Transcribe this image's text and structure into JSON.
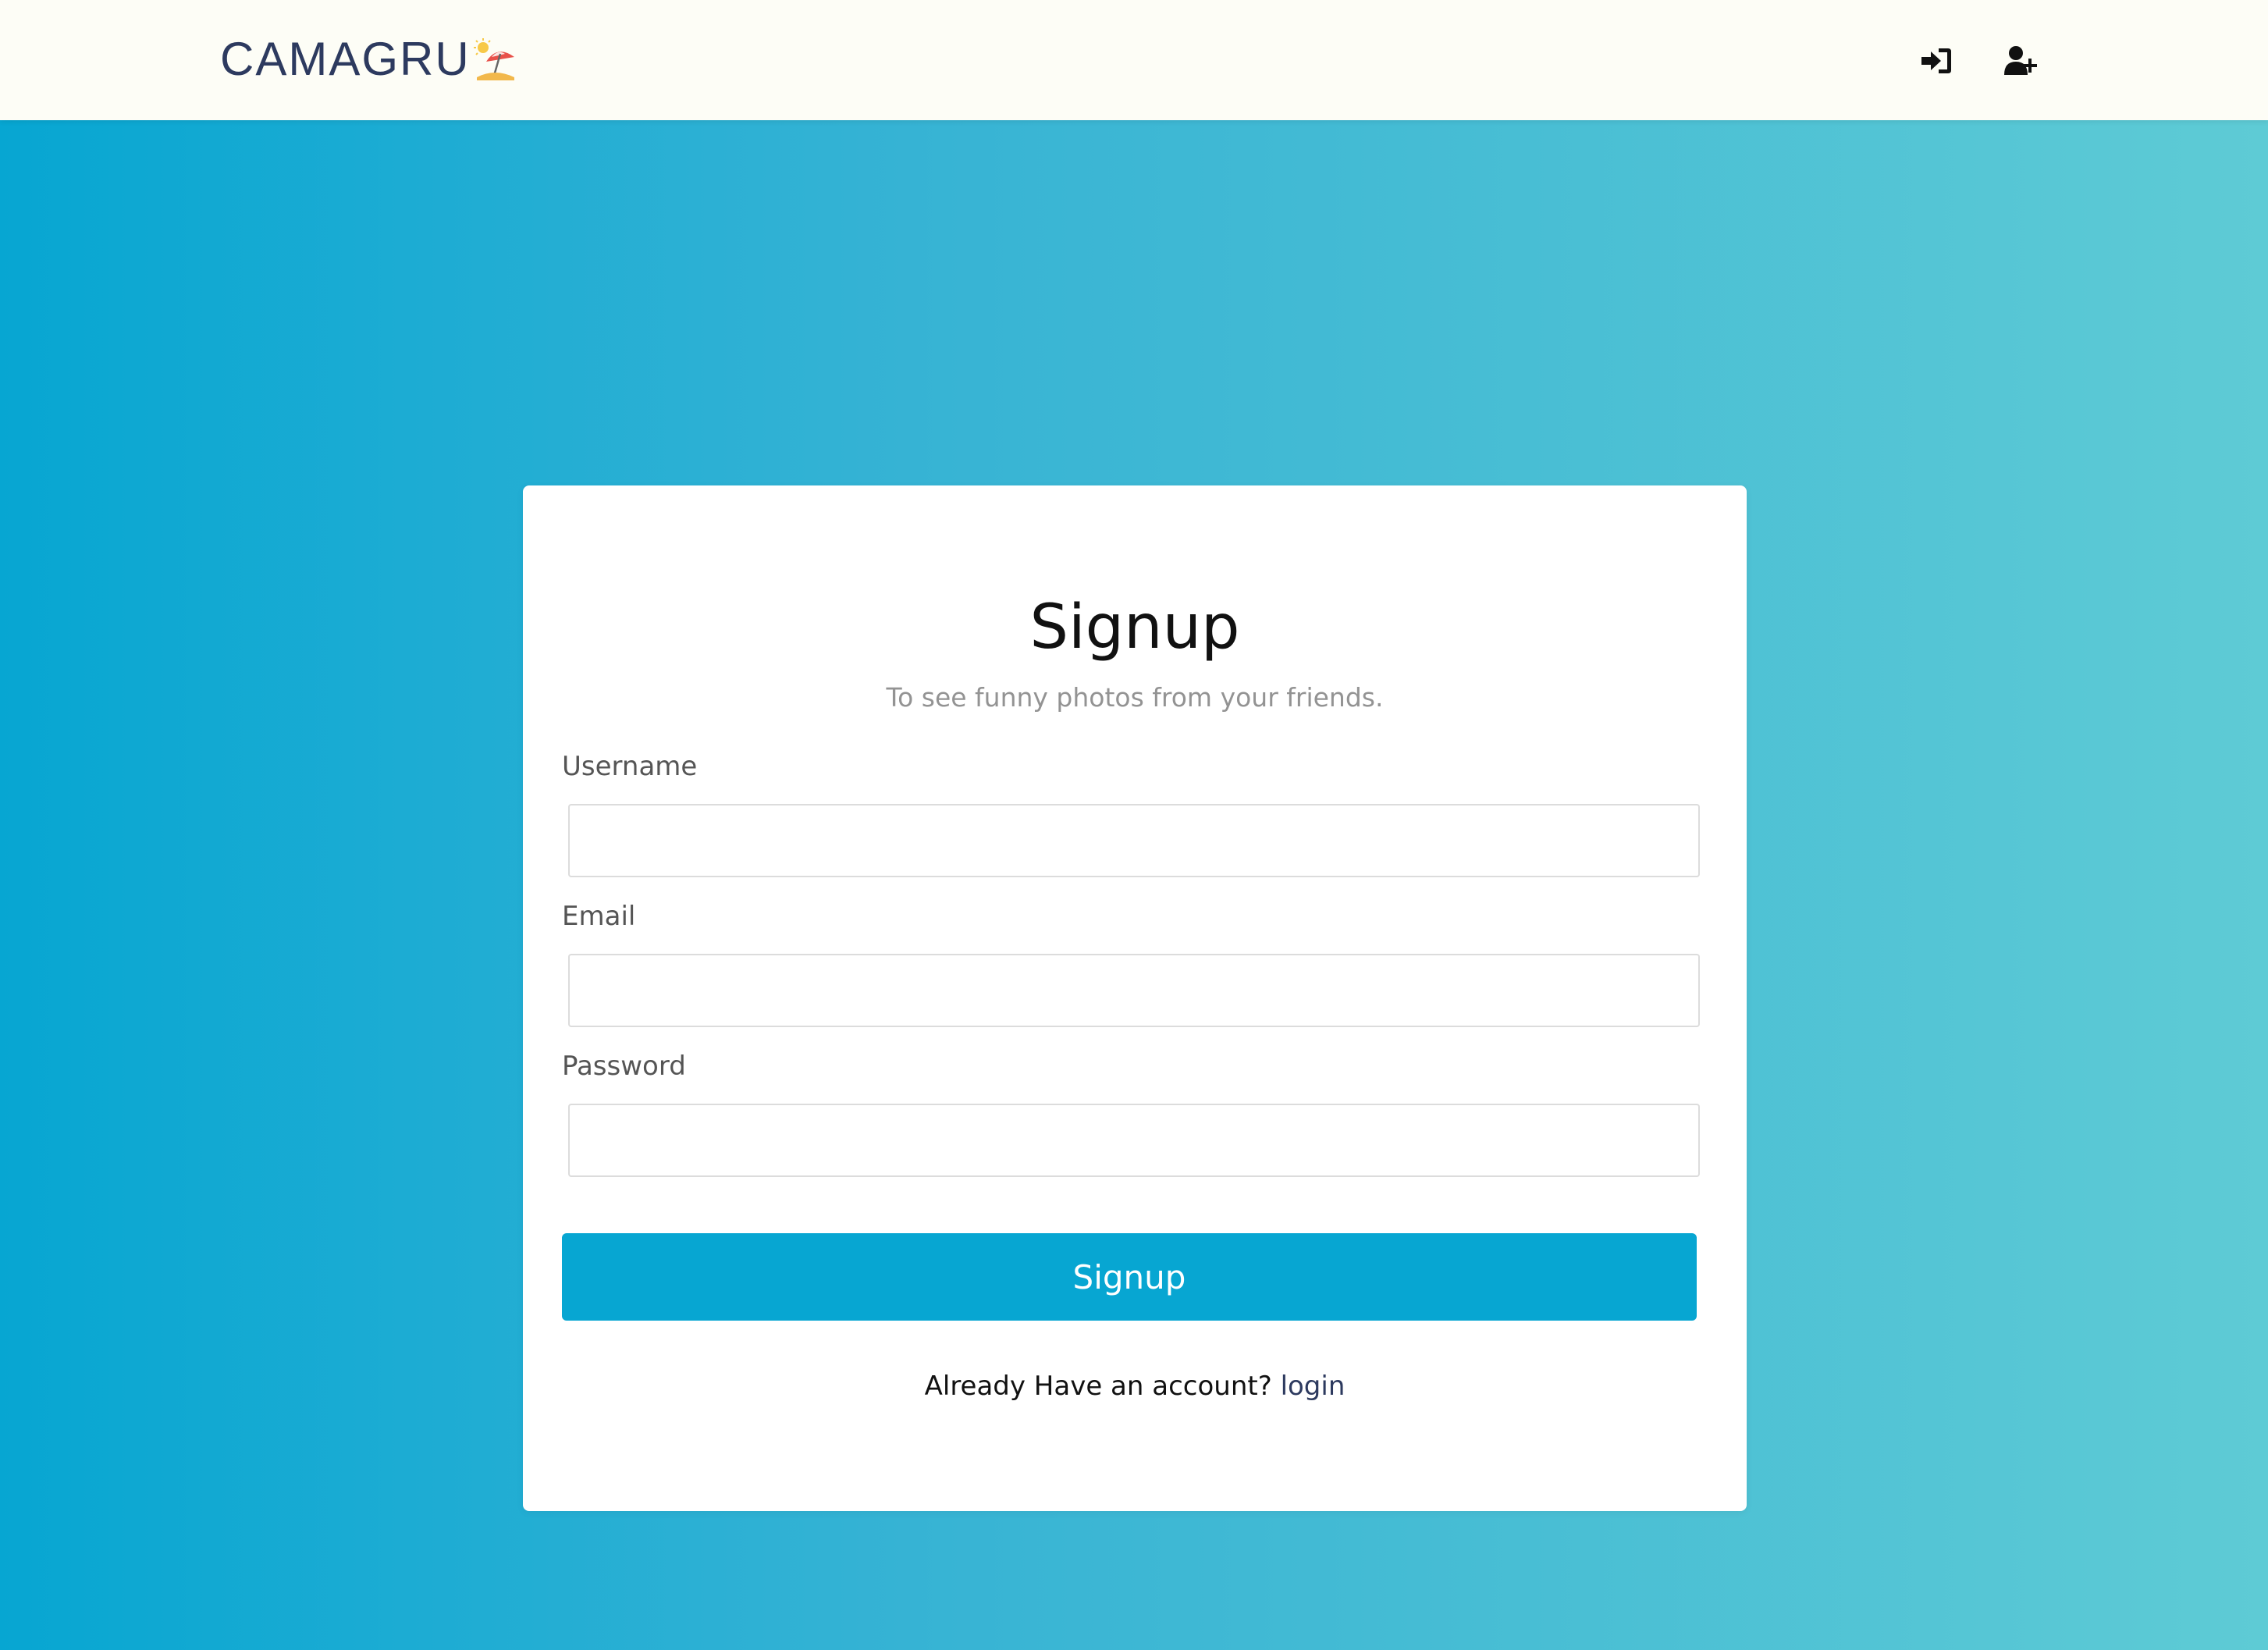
{
  "header": {
    "logo_text": "CAMAGRU",
    "logo_icon": "beach-umbrella-icon",
    "nav_items": [
      {
        "icon": "sign-in-icon",
        "label": "login"
      },
      {
        "icon": "user-plus-icon",
        "label": "signup"
      }
    ]
  },
  "form": {
    "title": "Signup",
    "subtitle": "To see funny photos from your friends.",
    "fields": [
      {
        "label": "Username",
        "value": "",
        "placeholder": ""
      },
      {
        "label": "Email",
        "value": "",
        "placeholder": ""
      },
      {
        "label": "Password",
        "value": "",
        "placeholder": ""
      }
    ],
    "submit_label": "Signup",
    "footer_prompt": "Already Have an account?",
    "footer_link": "login"
  },
  "colors": {
    "accent": "#07a6d2",
    "navbar_bg": "#fdfdf6",
    "logo_text": "#2d3a5f",
    "gradient_start": "#07a6d2",
    "gradient_end": "#5ecbd5"
  }
}
